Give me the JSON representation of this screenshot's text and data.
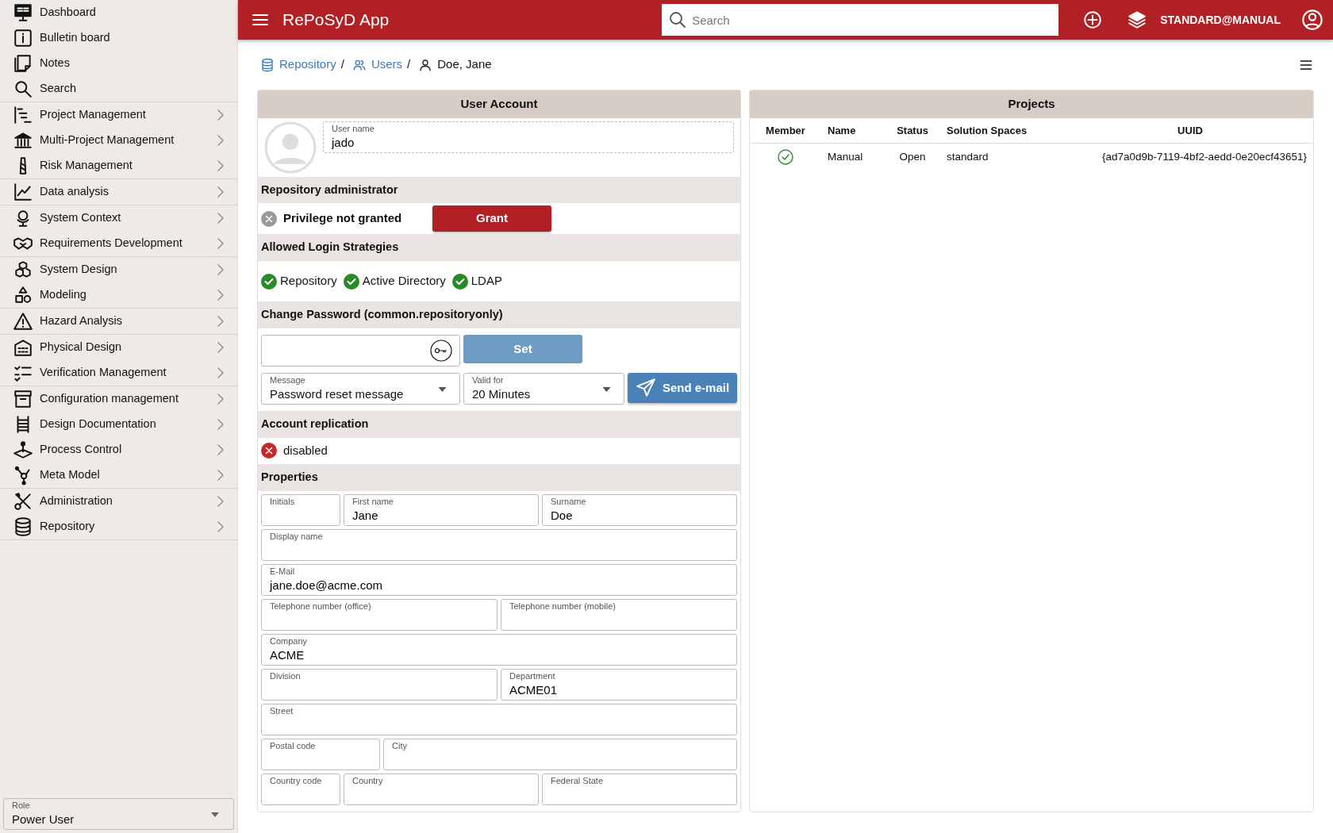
{
  "sidebar": {
    "groups": [
      {
        "items": [
          {
            "label": "Dashboard",
            "has_submenu": false
          },
          {
            "label": "Bulletin board",
            "has_submenu": false
          },
          {
            "label": "Notes",
            "has_submenu": false
          },
          {
            "label": "Search",
            "has_submenu": false
          }
        ]
      },
      {
        "items": [
          {
            "label": "Project Management",
            "has_submenu": true
          },
          {
            "label": "Multi-Project Management",
            "has_submenu": true
          },
          {
            "label": "Risk Management",
            "has_submenu": true
          }
        ]
      },
      {
        "items": [
          {
            "label": "Data analysis",
            "has_submenu": true
          }
        ]
      },
      {
        "items": [
          {
            "label": "System Context",
            "has_submenu": true
          },
          {
            "label": "Requirements Development",
            "has_submenu": true
          }
        ]
      },
      {
        "items": [
          {
            "label": "System Design",
            "has_submenu": true
          },
          {
            "label": "Modeling",
            "has_submenu": true
          }
        ]
      },
      {
        "items": [
          {
            "label": "Hazard Analysis",
            "has_submenu": true
          }
        ]
      },
      {
        "items": [
          {
            "label": "Physical Design",
            "has_submenu": true
          },
          {
            "label": "Verification Management",
            "has_submenu": true
          }
        ]
      },
      {
        "items": [
          {
            "label": "Configuration management",
            "has_submenu": true
          },
          {
            "label": "Design Documentation",
            "has_submenu": true
          },
          {
            "label": "Process Control",
            "has_submenu": true
          },
          {
            "label": "Meta Model",
            "has_submenu": true
          }
        ]
      },
      {
        "items": [
          {
            "label": "Administration",
            "has_submenu": true
          },
          {
            "label": "Repository",
            "has_submenu": true
          }
        ]
      }
    ],
    "role": {
      "label": "Role",
      "value": "Power User"
    }
  },
  "topbar": {
    "title": "RePoSyD App",
    "search": {
      "placeholder": "Search"
    },
    "context": "STANDARD@MANUAL"
  },
  "breadcrumb": [
    {
      "label": "Repository",
      "link": true,
      "separator": "/"
    },
    {
      "label": "Users",
      "link": true,
      "separator": "/"
    },
    {
      "label": "Doe, Jane",
      "link": false
    }
  ],
  "user_account": {
    "title": "User Account",
    "user_name": {
      "label": "User name",
      "value": "jado"
    },
    "repository_admin": {
      "heading": "Repository administrator",
      "granted": false,
      "status": "Privilege not granted",
      "button": "Grant"
    },
    "login_strategies": {
      "heading": "Allowed Login Strategies",
      "items": [
        {
          "label": "Repository",
          "enabled": true
        },
        {
          "label": "Active Directory",
          "enabled": true
        },
        {
          "label": "LDAP",
          "enabled": true
        }
      ]
    },
    "change_password": {
      "heading": "Change Password (common.repositoryonly)",
      "set_button": {
        "label": "Set",
        "disabled": true
      },
      "message": {
        "label": "Message",
        "value": "Password reset message"
      },
      "valid_for": {
        "label": "Valid for",
        "value": "20 Minutes"
      },
      "send_button": "Send e-mail"
    },
    "account_replication": {
      "heading": "Account replication",
      "enabled": false,
      "status": "disabled"
    },
    "properties": {
      "heading": "Properties",
      "rows": [
        [
          {
            "label": "Initials"
          },
          {
            "label": "First name",
            "value": "Jane"
          },
          {
            "label": "Surname",
            "value": "Doe"
          }
        ],
        [
          {
            "label": "Display name"
          }
        ],
        [
          {
            "label": "E-Mail",
            "value": "jane.doe@acme.com"
          }
        ],
        [
          {
            "label": "Telephone number (office)"
          },
          {
            "label": "Telephone number (mobile)"
          }
        ],
        [
          {
            "label": "Company",
            "value": "ACME"
          }
        ],
        [
          {
            "label": "Division"
          },
          {
            "label": "Department",
            "value": "ACME01"
          }
        ],
        [
          {
            "label": "Street"
          }
        ],
        [
          {
            "label": "Postal code"
          },
          {
            "label": "City"
          }
        ],
        [
          {
            "label": "Country code"
          },
          {
            "label": "Country"
          },
          {
            "label": "Federal State"
          }
        ]
      ]
    }
  },
  "projects": {
    "title": "Projects",
    "columns": [
      "Member",
      "Name",
      "Status",
      "Solution Spaces",
      "UUID"
    ],
    "rows": [
      {
        "member": true,
        "name": "Manual",
        "status": "Open",
        "solution_spaces": "standard",
        "uuid": "{ad7a0d9b-7119-4bf2-aedd-0e20ecf43651}"
      }
    ]
  }
}
